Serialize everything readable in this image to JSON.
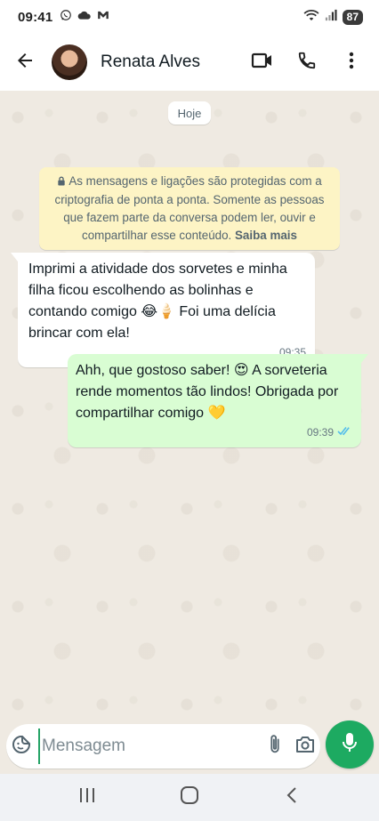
{
  "status_bar": {
    "time": "09:41",
    "battery": "87",
    "icons_left": [
      "whatsapp-icon",
      "cloud-icon",
      "gmail-icon"
    ],
    "icons_right": [
      "wifi-icon",
      "signal-icon",
      "battery-icon"
    ]
  },
  "header": {
    "contact_name": "Renata Alves",
    "icons": [
      "back-arrow-icon",
      "video-call-icon",
      "phone-icon",
      "more-vert-icon"
    ]
  },
  "chat": {
    "date_chip": "Hoje",
    "encryption_note": {
      "text": "As mensagens e ligações são protegidas com a criptografia de ponta a ponta. Somente as pessoas que fazem parte da conversa podem ler, ouvir e compartilhar esse conteúdo.",
      "link": "Saiba mais"
    },
    "messages": [
      {
        "direction": "incoming",
        "text_parts": [
          "Imprimi a atividade dos sorvetes e minha filha ficou escolhendo as bolinhas e contando comigo ",
          "😂",
          "🍦",
          " Foi uma delícia brincar com ela!"
        ],
        "time": "09:35"
      },
      {
        "direction": "outgoing",
        "text_parts": [
          "Ahh, que gostoso saber! ",
          "😍",
          " A sorveteria rende momentos tão lindos! Obrigada por compartilhar comigo ",
          "💛"
        ],
        "time": "09:39",
        "status": "read"
      }
    ]
  },
  "composer": {
    "placeholder": "Mensagem",
    "value": "",
    "icons": [
      "sticker-icon",
      "attach-icon",
      "camera-icon",
      "mic-icon"
    ]
  },
  "colors": {
    "outgoing_bubble": "#d9fdd3",
    "incoming_bubble": "#ffffff",
    "encryption_bg": "#fdf4c5",
    "accent_green": "#1daa61",
    "read_ticks": "#53bdeb",
    "chat_bg": "#efeae2"
  }
}
